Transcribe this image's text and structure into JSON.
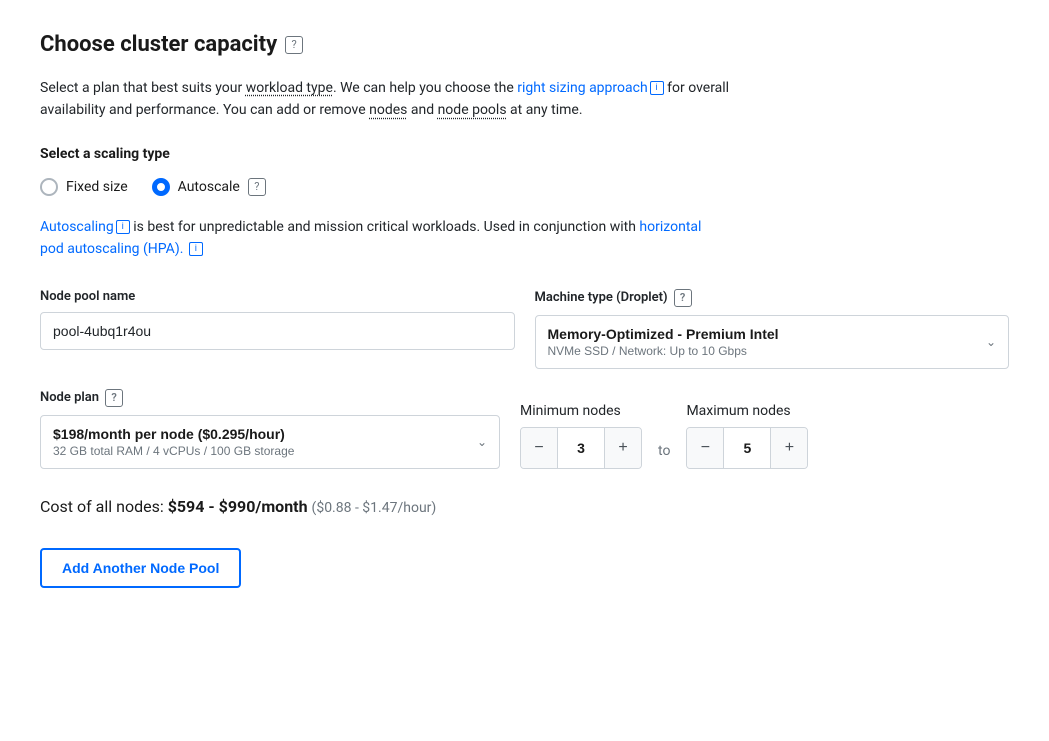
{
  "page": {
    "title": "Choose cluster capacity",
    "help_icon": "?",
    "description_parts": [
      "Select a plan that best suits your workload type. We can help you choose the ",
      "right sizing approach",
      " for overall availability and performance. You can add or remove ",
      "nodes",
      " and ",
      "node pools",
      " at any time."
    ],
    "description_link1": "right sizing approach",
    "description_link2": "horizontal pod autoscaling (HPA).",
    "scaling_section_label": "Select a scaling type",
    "scaling_options": [
      {
        "id": "fixed",
        "label": "Fixed size",
        "checked": false
      },
      {
        "id": "autoscale",
        "label": "Autoscale",
        "checked": true
      }
    ],
    "autoscale_help_icon": "?",
    "autoscale_description_pre": "Autoscaling",
    "autoscale_description_body": " is best for unpredictable and mission critical workloads. Used in conjunction with ",
    "autoscale_hpa_link": "horizontal pod autoscaling (HPA).",
    "node_pool_name_label": "Node pool name",
    "node_pool_name_value": "pool-4ubq1r4ou",
    "node_pool_name_placeholder": "pool-4ubq1r4ou",
    "machine_type_label": "Machine type (Droplet)",
    "machine_type_help": "?",
    "machine_type_main": "Memory-Optimized - Premium Intel",
    "machine_type_sub": "NVMe SSD / Network: Up to 10 Gbps",
    "node_plan_label": "Node plan",
    "node_plan_help": "?",
    "node_plan_main": "$198/month per node ($0.295/hour)",
    "node_plan_sub": "32 GB total RAM / 4 vCPUs / 100 GB storage",
    "minimum_nodes_label": "Minimum nodes",
    "minimum_nodes_value": "3",
    "maximum_nodes_label": "Maximum nodes",
    "maximum_nodes_value": "5",
    "to_label": "to",
    "cost_label": "Cost of all nodes:",
    "cost_main": "$594 - $990/month",
    "cost_secondary": "($0.88 - $1.47/hour)",
    "add_pool_button": "Add Another Node Pool"
  }
}
